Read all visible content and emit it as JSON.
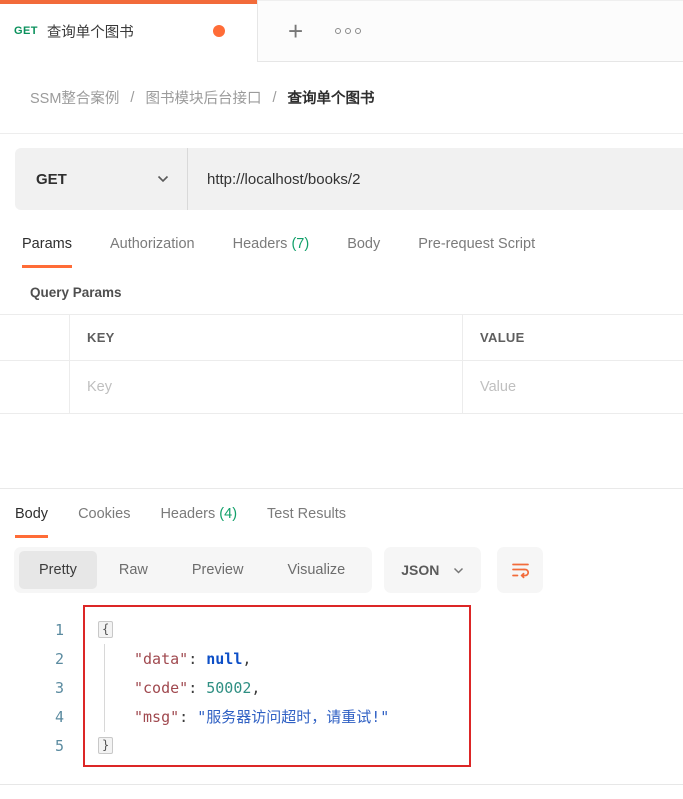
{
  "colors": {
    "accent_orange": "#ff6c37",
    "method_green": "#0a915c",
    "count_green": "#12a06a",
    "annotation_red": "#dc2626"
  },
  "tab_bar": {
    "active_tab": {
      "method": "GET",
      "title": "查询单个图书",
      "unsaved_dot": true
    },
    "new_tab_glyph": "+"
  },
  "breadcrumb": {
    "separator": "/",
    "items": [
      "SSM整合案例",
      "图书模块后台接口",
      "查询单个图书"
    ]
  },
  "request": {
    "method": "GET",
    "url": "http://localhost/books/2"
  },
  "request_tabs": {
    "items": [
      {
        "label": "Params",
        "active": true
      },
      {
        "label": "Authorization"
      },
      {
        "label": "Headers",
        "count": "(7)"
      },
      {
        "label": "Body"
      },
      {
        "label": "Pre-request Script"
      }
    ]
  },
  "query_params": {
    "title": "Query Params",
    "columns": [
      "KEY",
      "VALUE"
    ],
    "row": {
      "key_placeholder": "Key",
      "value_placeholder": "Value"
    }
  },
  "response": {
    "tabs": [
      {
        "label": "Body",
        "active": true
      },
      {
        "label": "Cookies"
      },
      {
        "label": "Headers",
        "count": "(4)"
      },
      {
        "label": "Test Results"
      }
    ],
    "views": [
      {
        "label": "Pretty",
        "selected": true
      },
      {
        "label": "Raw"
      },
      {
        "label": "Preview"
      },
      {
        "label": "Visualize"
      }
    ],
    "format": "JSON",
    "body": {
      "line_numbers": [
        "1",
        "2",
        "3",
        "4",
        "5"
      ],
      "l1": {
        "brace": "{"
      },
      "l2": {
        "key": "\"data\"",
        "colon": ": ",
        "value": "null",
        "comma": ","
      },
      "l3": {
        "key": "\"code\"",
        "colon": ": ",
        "value": "50002",
        "comma": ","
      },
      "l4": {
        "key": "\"msg\"",
        "colon": ": ",
        "value": "\"服务器访问超时，请重试!\""
      },
      "l5": {
        "brace": "}"
      }
    }
  }
}
